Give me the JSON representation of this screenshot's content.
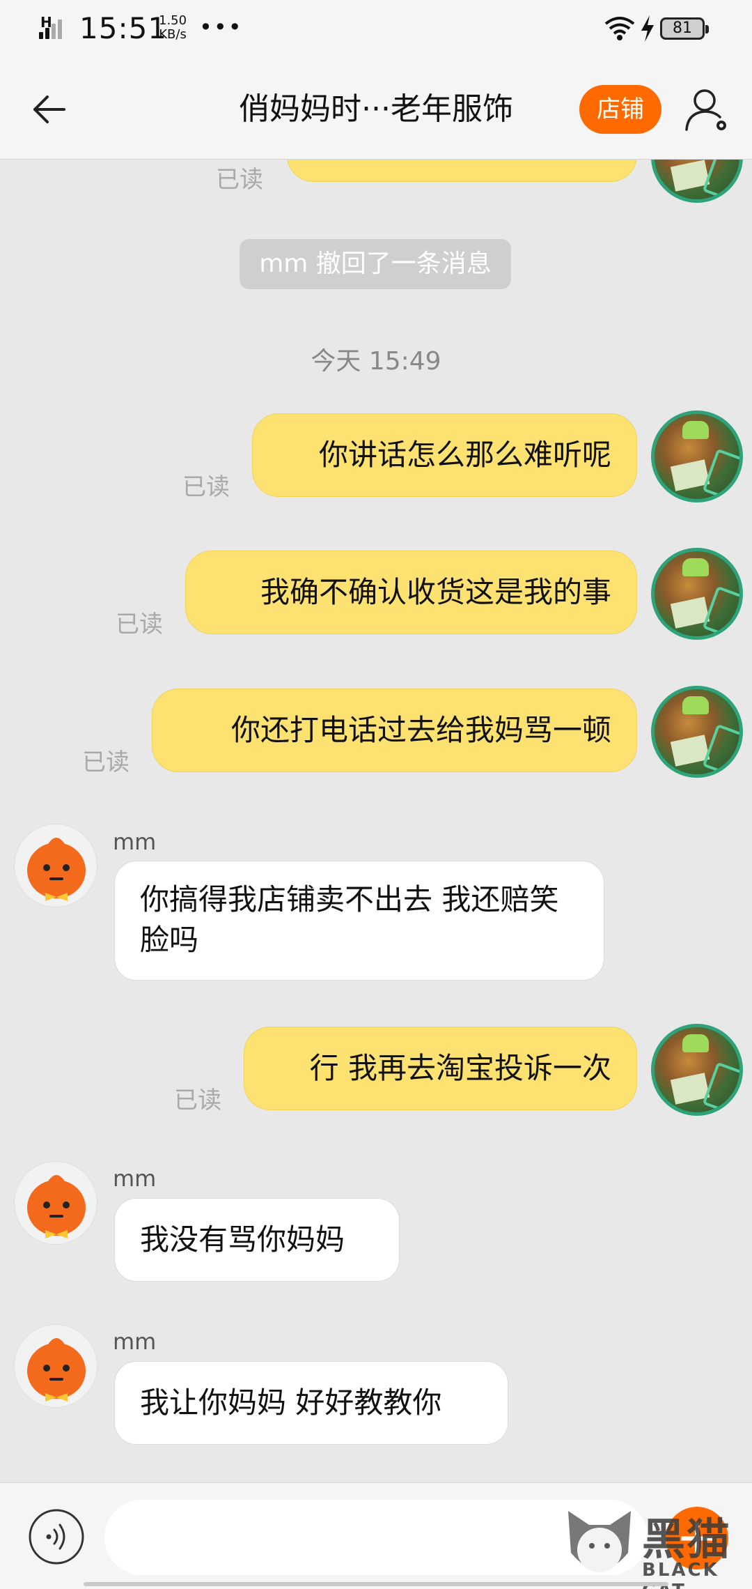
{
  "status_bar": {
    "network": "H",
    "time": "15:51",
    "speed_value": "1.50",
    "speed_unit": "KB/s",
    "battery": "81"
  },
  "header": {
    "title": "俏妈妈时···老年服饰",
    "shop_label": "店铺"
  },
  "chat": {
    "partial_read_label": "已读",
    "recall_notice": "mm 撤回了一条消息",
    "time_separator": "今天  15:49",
    "messages": [
      {
        "side": "right",
        "text": "你讲话怎么那么难听呢",
        "status": "已读"
      },
      {
        "side": "right",
        "text": "我确不确认收货这是我的事",
        "status": "已读"
      },
      {
        "side": "right",
        "text": "你还打电话过去给我妈骂一顿",
        "status": "已读"
      },
      {
        "side": "left",
        "sender": "mm",
        "text": "你搞得我店铺卖不出去 我还赔笑脸吗"
      },
      {
        "side": "right",
        "text": "行 我再去淘宝投诉一次",
        "status": "已读"
      },
      {
        "side": "left",
        "sender": "mm",
        "text": "我没有骂你妈妈"
      },
      {
        "side": "left",
        "sender": "mm",
        "text": "我让你妈妈 好好教教你"
      }
    ]
  },
  "input_bar": {
    "placeholder": ""
  },
  "watermark": {
    "cn": "黑猫",
    "en": "BLACK CAT"
  },
  "colors": {
    "accent": "#ff6a00",
    "bubble_self": "#fde272",
    "bubble_other": "#ffffff",
    "background": "#e8e8e8"
  }
}
